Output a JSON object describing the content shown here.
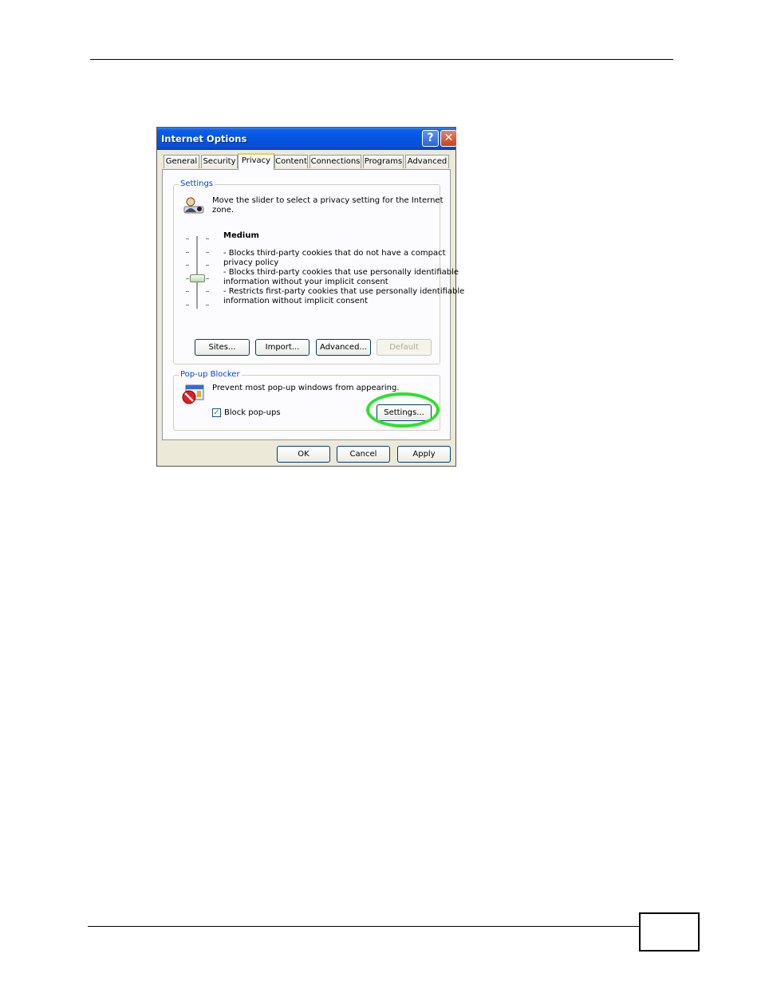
{
  "dialog": {
    "title": "Internet Options",
    "help_glyph": "?",
    "close_glyph": "✕",
    "tabs": [
      {
        "label": "General"
      },
      {
        "label": "Security"
      },
      {
        "label": "Privacy"
      },
      {
        "label": "Content"
      },
      {
        "label": "Connections"
      },
      {
        "label": "Programs"
      },
      {
        "label": "Advanced"
      }
    ],
    "active_tab": "Privacy"
  },
  "settings": {
    "group_label": "Settings",
    "description_line1": "Move the slider to select a privacy setting for the Internet",
    "description_line2": "zone.",
    "level_title": "Medium",
    "level_lines": [
      "- Blocks third-party cookies that do not have a compact",
      "privacy policy",
      "- Blocks third-party cookies that use personally identifiable",
      "information without your implicit consent",
      "- Restricts first-party cookies that use personally identifiable",
      "information without implicit consent"
    ],
    "slider_level": "Medium",
    "buttons": {
      "sites": "Sites...",
      "import": "Import...",
      "advanced": "Advanced...",
      "default": "Default"
    }
  },
  "popup": {
    "group_label": "Pop-up Blocker",
    "description": "Prevent most pop-up windows from appearing.",
    "block_label": "Block pop-ups",
    "block_checked": true,
    "settings_button": "Settings..."
  },
  "footer": {
    "ok": "OK",
    "cancel": "Cancel",
    "apply": "Apply"
  },
  "colors": {
    "titlebar": "#0554e0",
    "group_label": "#0046d5",
    "highlight": "#28e428"
  }
}
